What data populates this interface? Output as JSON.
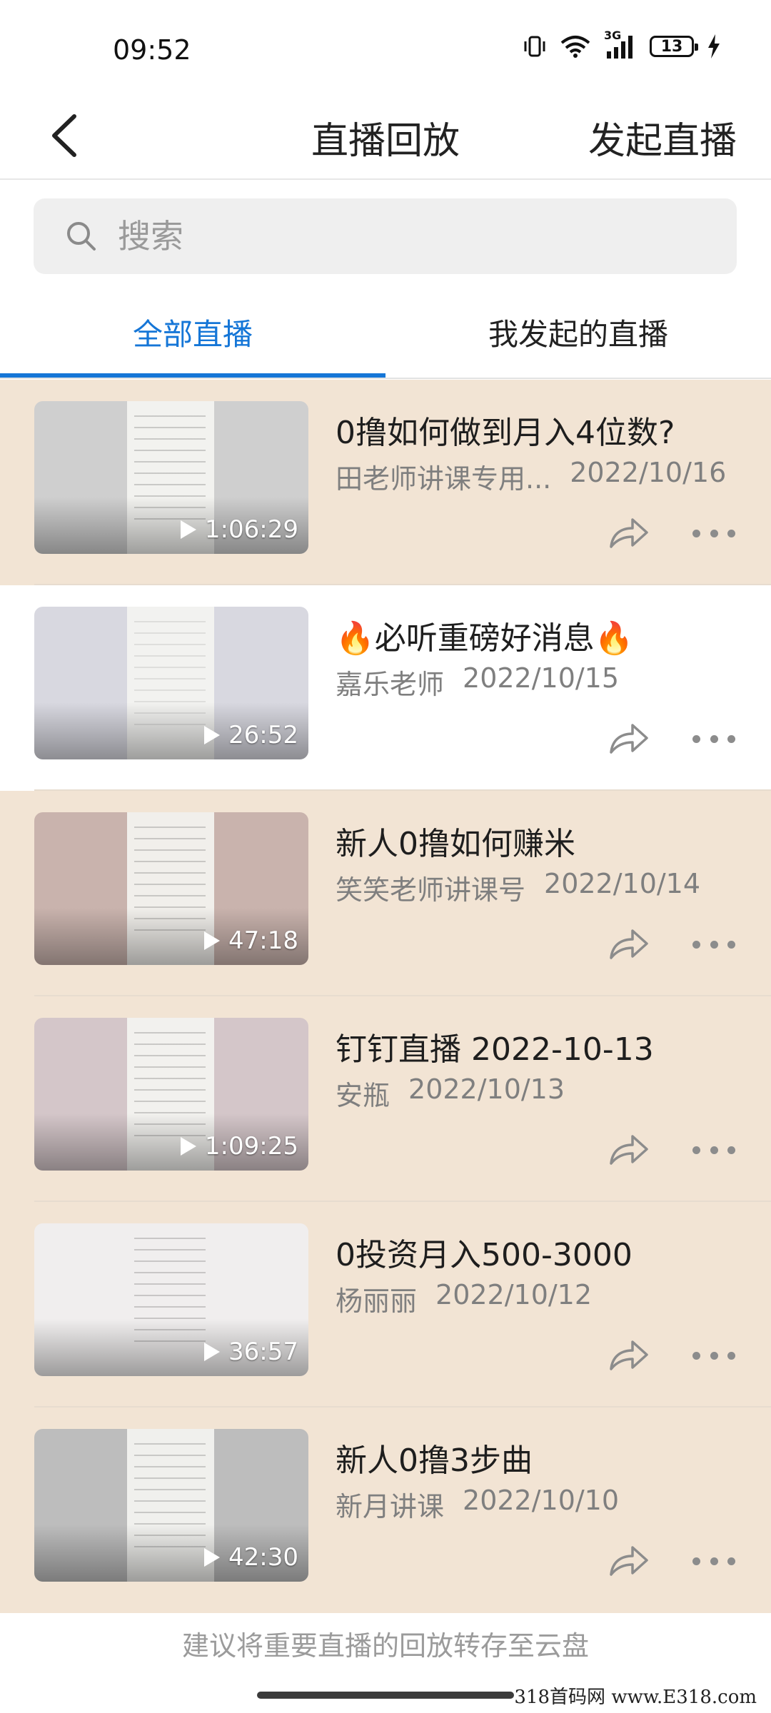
{
  "status_bar": {
    "time": "09:52",
    "network": "3G",
    "battery": "13"
  },
  "nav": {
    "title": "直播回放",
    "action": "发起直播"
  },
  "search": {
    "placeholder": "搜索"
  },
  "tabs": [
    {
      "label": "全部直播",
      "active": true
    },
    {
      "label": "我发起的直播",
      "active": false
    }
  ],
  "items": [
    {
      "title": "0撸如何做到月入4位数?",
      "host": "田老师讲课专用...",
      "date": "2022/10/16",
      "duration": "1:06:29"
    },
    {
      "title": "🔥必听重磅好消息🔥",
      "host": "嘉乐老师",
      "date": "2022/10/15",
      "duration": "26:52"
    },
    {
      "title": "新人0撸如何赚米",
      "host": "笑笑老师讲课号",
      "date": "2022/10/14",
      "duration": "47:18"
    },
    {
      "title": "钉钉直播 2022-10-13",
      "host": "安瓶",
      "date": "2022/10/13",
      "duration": "1:09:25"
    },
    {
      "title": "0投资月入500-3000",
      "host": "杨丽丽",
      "date": "2022/10/12",
      "duration": "36:57"
    },
    {
      "title": "新人0撸3步曲",
      "host": "新月讲课",
      "date": "2022/10/10",
      "duration": "42:30"
    }
  ],
  "footer": {
    "note": "建议将重要直播的回放转存至云盘"
  },
  "watermark": "318首码网 www.E318.com",
  "colors": {
    "accent": "#1576d7",
    "row_highlight": "#f2e4d4"
  }
}
